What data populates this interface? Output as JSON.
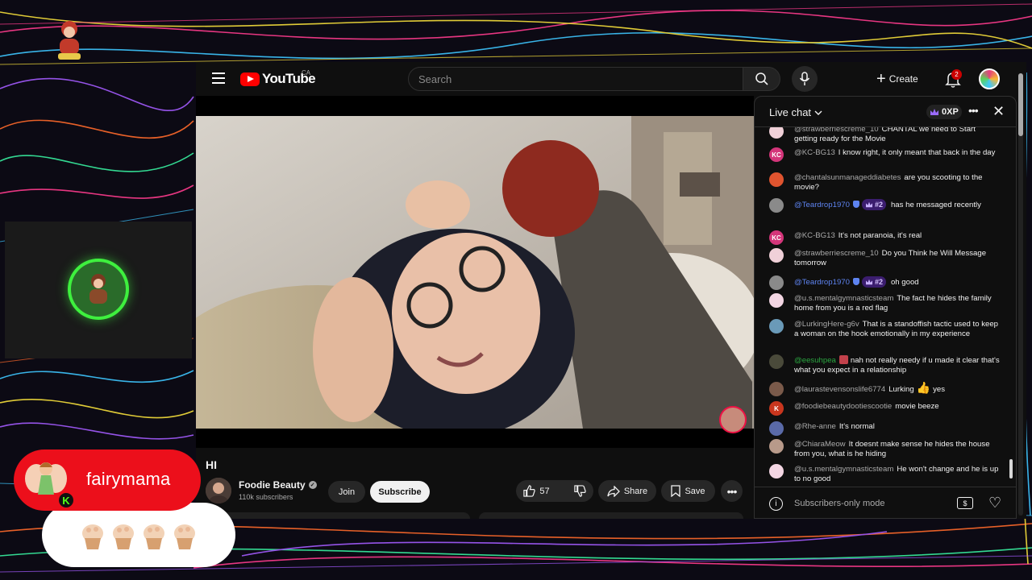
{
  "overlay": {
    "username": "fairymama",
    "kick_badge": "K"
  },
  "header": {
    "logo_text": "YouTube",
    "country_code": "CA",
    "search_placeholder": "Search",
    "create_label": "Create",
    "notification_count": "2"
  },
  "video": {
    "title": "HI",
    "channel_name": "Foodie Beauty",
    "subscribers": "110k subscribers",
    "join_label": "Join",
    "subscribe_label": "Subscribe",
    "like_count": "57",
    "share_label": "Share",
    "save_label": "Save"
  },
  "chat": {
    "title": "Live chat",
    "xp_label": "0XP",
    "footer_text": "Subscribers-only mode",
    "messages": [
      {
        "author": "@strawberriescreme_10",
        "text": "CHANTAL we need to Start getting ready for the Movie"
      },
      {
        "author": "@KC-BG13",
        "text": "I know right, it only meant that back in the day"
      },
      {
        "author": "@chantalsunmanageddiabetes",
        "text": "are you scooting to the movie?"
      },
      {
        "author": "@Teardrop1970",
        "rank": "#2",
        "text": "has he messaged recently"
      },
      {
        "author": "@KC-BG13",
        "text": "It's not paranoia, it's real"
      },
      {
        "author": "@strawberriescreme_10",
        "text": "Do you Think he Will Message tomorrow"
      },
      {
        "author": "@Teardrop1970",
        "rank": "#2",
        "text": "oh good"
      },
      {
        "author": "@u.s.mentalgymnasticsteam",
        "text": "The fact he hides the family home from you is a red flag"
      },
      {
        "author": "@LurkingHere-g6v",
        "text": "That is a standoffish tactic used to keep a woman on the hook emotionally in my experience"
      },
      {
        "author": "@eesuhpea",
        "text": "nah not really needy if u made it clear that's what you expect in a relationship"
      },
      {
        "author": "@laurastevensonslife6774",
        "text": "Lurking",
        "text2": "yes"
      },
      {
        "author": "@foodiebeautydootiescootie",
        "text": "movie beeze"
      },
      {
        "author": "@Rhe-anne",
        "text": "It's normal"
      },
      {
        "author": "@ChiaraMeow",
        "text": "It doesnt make sense he hides the house from you, what is he hiding"
      },
      {
        "author": "@u.s.mentalgymnasticsteam",
        "text": "He won't change and he is up to no good"
      }
    ],
    "avatar_initials": {
      "kc": "KC",
      "k": "K"
    }
  },
  "colors": {
    "youtube_red": "#ff0000",
    "kick_green": "#53fc18",
    "name_pill_red": "#ec0f1b",
    "moderator_blue": "#5e84f1"
  },
  "icons": [
    "menu-icon",
    "search-icon",
    "mic-icon",
    "plus-icon",
    "bell-icon",
    "like-icon",
    "dislike-icon",
    "share-icon",
    "save-icon",
    "more-icon",
    "chevron-down-icon",
    "crown-icon",
    "close-icon",
    "info-icon",
    "dollar-icon",
    "heart-icon"
  ]
}
